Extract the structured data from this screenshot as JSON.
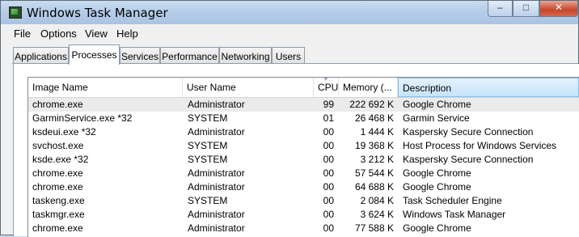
{
  "window": {
    "title": "Windows Task Manager",
    "icon": "task-manager-icon",
    "controls": {
      "minimize": "–",
      "maximize": "□",
      "close": "✕"
    }
  },
  "menu": [
    "File",
    "Options",
    "View",
    "Help"
  ],
  "tabs": [
    {
      "label": "Applications",
      "active": false
    },
    {
      "label": "Processes",
      "active": true
    },
    {
      "label": "Services",
      "active": false
    },
    {
      "label": "Performance",
      "active": false
    },
    {
      "label": "Networking",
      "active": false
    },
    {
      "label": "Users",
      "active": false
    }
  ],
  "columns": {
    "image_name": "Image Name",
    "user_name": "User Name",
    "cpu": "CPU",
    "memory": "Memory (...",
    "description": "Description"
  },
  "processes": [
    {
      "name": "chrome.exe",
      "user": "Administrator",
      "cpu": "99",
      "memory": "222 692 K",
      "description": "Google Chrome",
      "selected": true
    },
    {
      "name": "GarminService.exe *32",
      "user": "SYSTEM",
      "cpu": "01",
      "memory": "26 468 K",
      "description": "Garmin Service"
    },
    {
      "name": "ksdeui.exe *32",
      "user": "Administrator",
      "cpu": "00",
      "memory": "1 444 K",
      "description": "Kaspersky Secure Connection"
    },
    {
      "name": "svchost.exe",
      "user": "SYSTEM",
      "cpu": "00",
      "memory": "19 368 K",
      "description": "Host Process for Windows Services"
    },
    {
      "name": "ksde.exe *32",
      "user": "SYSTEM",
      "cpu": "00",
      "memory": "3 212 K",
      "description": "Kaspersky Secure Connection"
    },
    {
      "name": "chrome.exe",
      "user": "Administrator",
      "cpu": "00",
      "memory": "57 544 K",
      "description": "Google Chrome"
    },
    {
      "name": "chrome.exe",
      "user": "Administrator",
      "cpu": "00",
      "memory": "64 688 K",
      "description": "Google Chrome"
    },
    {
      "name": "taskeng.exe",
      "user": "SYSTEM",
      "cpu": "00",
      "memory": "2 084 K",
      "description": "Task Scheduler Engine"
    },
    {
      "name": "taskmgr.exe",
      "user": "Administrator",
      "cpu": "00",
      "memory": "3 624 K",
      "description": "Windows Task Manager"
    },
    {
      "name": "chrome.exe",
      "user": "Administrator",
      "cpu": "00",
      "memory": "77 588 K",
      "description": "Google Chrome"
    }
  ],
  "colors": {
    "title_bar": "#b6cde8",
    "selected_column_header": "#c5e4f9",
    "selected_row": "#ebebeb",
    "close_button": "#c8452b"
  }
}
